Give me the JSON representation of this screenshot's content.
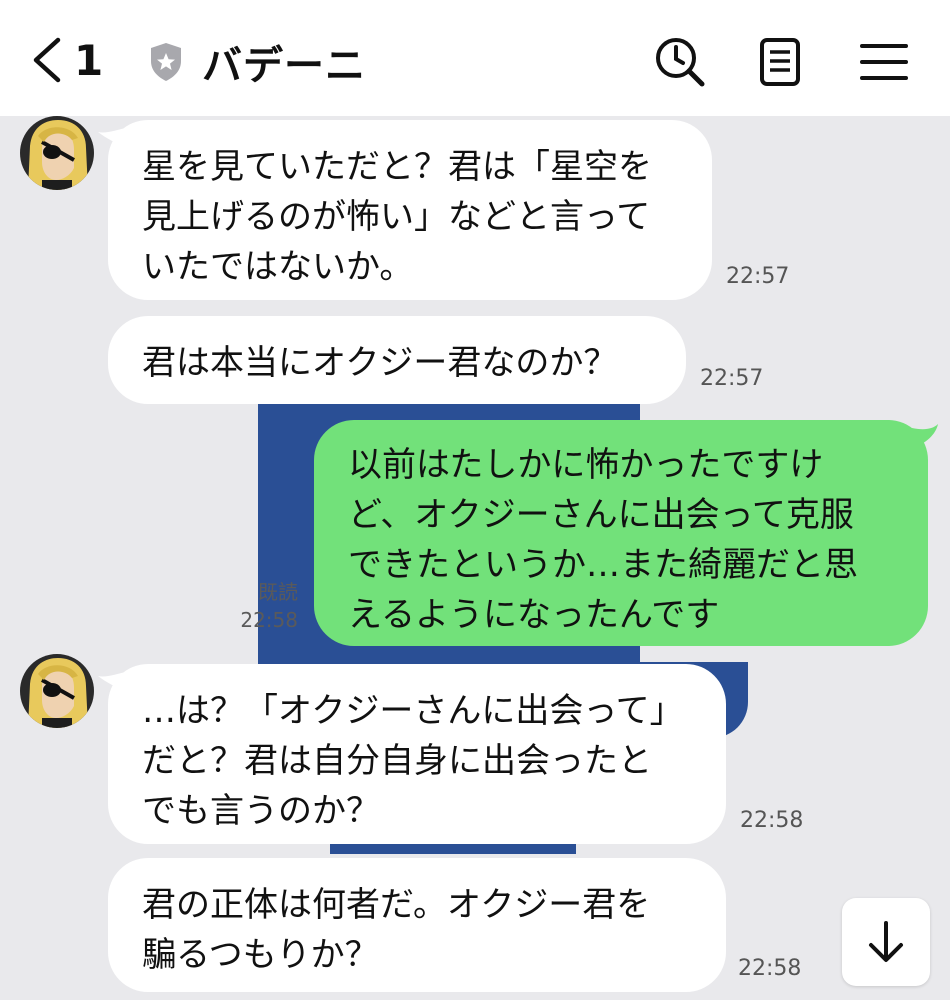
{
  "header": {
    "back_count": "1",
    "room_title": "バデーニ",
    "icons": [
      "chevron-left-icon",
      "shield-star-icon",
      "search-history-icon",
      "notes-icon",
      "menu-icon"
    ]
  },
  "messages": [
    {
      "id": "m1",
      "side": "left",
      "text": "星を見ていただと？君は「星空を\n見上げるのが怖い」などと言って\nいたではないか。",
      "time": "22:57",
      "has_avatar": true
    },
    {
      "id": "m2",
      "side": "left",
      "text": "君は本当にオクジー君なのか？",
      "time": "22:57",
      "has_avatar": false
    },
    {
      "id": "m3",
      "side": "right",
      "text": "以前はたしかに怖かったですけ\nど、オクジーさんに出会って克服\nできたというか…また綺麗だと思\nえるようになったんです",
      "read": "既読",
      "time": "22:58"
    },
    {
      "id": "m4",
      "side": "left",
      "text": "…は？「オクジーさんに出会って」\nだと？君は自分自身に出会ったと\nでも言うのか？",
      "time": "22:58",
      "has_avatar": true
    },
    {
      "id": "m5",
      "side": "left",
      "text": "君の正体は何者だ。オクジー君を\n騙るつもりか？",
      "time": "22:58",
      "has_avatar": false
    }
  ],
  "colors": {
    "chat_bg": "#e9e9ec",
    "my_bubble": "#72e17a",
    "their_bubble": "#ffffff",
    "bg_image_blue": "#2a4f95"
  },
  "scroll_button_icon": "arrow-down-icon"
}
